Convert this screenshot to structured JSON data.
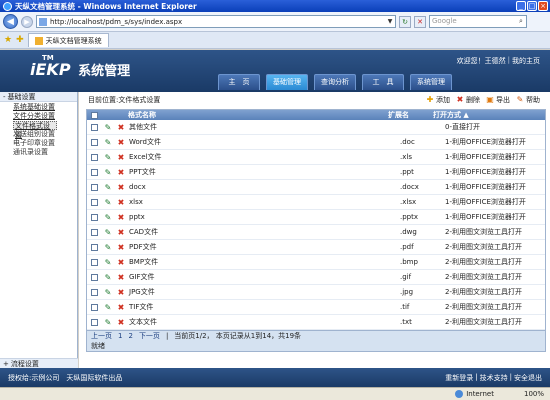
{
  "window": {
    "title": "天纵文档管理系统 - Windows Internet Explorer",
    "minimize": "_",
    "maximize": "□",
    "close": "×"
  },
  "addressbar": {
    "url": "http://localhost/pdm_s/sys/index.aspx",
    "search_placeholder": "Google",
    "back": "◀",
    "forward": "▶"
  },
  "browser_tab": {
    "label": "天纵文档管理系统"
  },
  "header": {
    "logo_tm": "TM",
    "logo_text": "iEKP",
    "logo_cn": "系统管理",
    "welcome": "欢迎您！王德然",
    "my_home": "我的主页",
    "nav": [
      "主　页",
      "基础管理",
      "查询分析",
      "工　具",
      "系统管理"
    ],
    "active_nav": 1
  },
  "sidebar": {
    "section": "基础设置",
    "items": [
      {
        "label": "系统基础设置",
        "style": "link"
      },
      {
        "label": "文件分类设置",
        "style": "link"
      },
      {
        "label": "文件格式设置",
        "style": "selected"
      },
      {
        "label": "发送组别设置",
        "style": "plain"
      },
      {
        "label": "电子印章设置",
        "style": "plain"
      },
      {
        "label": "通讯录设置",
        "style": "plain"
      }
    ],
    "footer_section": "流程设置",
    "collapse_glyph": "-",
    "expand_glyph": "+"
  },
  "main": {
    "breadcrumb": "目前位置:文件格式设置",
    "actions": {
      "add": "添加",
      "delete": "删除",
      "export": "导出",
      "help": "帮助"
    },
    "columns": {
      "name": "格式名称",
      "ext": "扩展名",
      "open": "打开方式 ▲"
    },
    "rows": [
      {
        "name": "其他文件",
        "ext": "",
        "open": "0-直接打开"
      },
      {
        "name": "Word文件",
        "ext": ".doc",
        "open": "1-利用OFFICE浏览器打开"
      },
      {
        "name": "Excel文件",
        "ext": ".xls",
        "open": "1-利用OFFICE浏览器打开"
      },
      {
        "name": "PPT文件",
        "ext": ".ppt",
        "open": "1-利用OFFICE浏览器打开"
      },
      {
        "name": "docx",
        "ext": ".docx",
        "open": "1-利用OFFICE浏览器打开"
      },
      {
        "name": "xlsx",
        "ext": ".xlsx",
        "open": "1-利用OFFICE浏览器打开"
      },
      {
        "name": "pptx",
        "ext": ".pptx",
        "open": "1-利用OFFICE浏览器打开"
      },
      {
        "name": "CAD文件",
        "ext": ".dwg",
        "open": "2-利用图文浏览工具打开"
      },
      {
        "name": "PDF文件",
        "ext": ".pdf",
        "open": "2-利用图文浏览工具打开"
      },
      {
        "name": "BMP文件",
        "ext": ".bmp",
        "open": "2-利用图文浏览工具打开"
      },
      {
        "name": "GIF文件",
        "ext": ".gif",
        "open": "2-利用图文浏览工具打开"
      },
      {
        "name": "JPG文件",
        "ext": ".jpg",
        "open": "2-利用图文浏览工具打开"
      },
      {
        "name": "TIF文件",
        "ext": ".tif",
        "open": "2-利用图文浏览工具打开"
      },
      {
        "name": "文本文件",
        "ext": ".txt",
        "open": "2-利用图文浏览工具打开"
      }
    ],
    "pager": {
      "prev": "上一页",
      "page1": "1",
      "page2": "2",
      "next": "下一页",
      "summary": "当前页1/2， 本页记录从1到14，共19条"
    },
    "status": "就绪"
  },
  "footer": {
    "copyright": "授权给:示例公司　天纵国际软件出品",
    "relogin": "重新登录",
    "support": "技术支持",
    "logout": "安全退出"
  },
  "iestatus": {
    "zone": "Internet",
    "zoom": "100%"
  }
}
